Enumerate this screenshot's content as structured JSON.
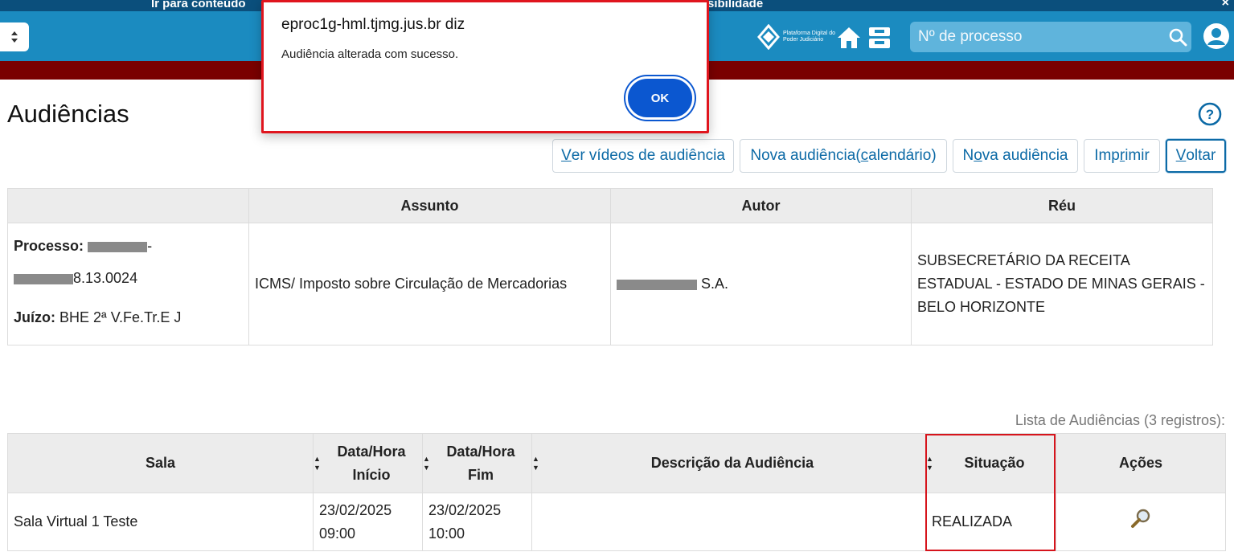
{
  "topbar": {
    "skip_content": "Ir para conteúdo",
    "accessibility": "sibilidade",
    "close": "×"
  },
  "header": {
    "logo_text": "Plataforma Digital do Poder Judiciário",
    "search_placeholder": "Nº de processo",
    "icons": [
      "select-arrows-icon",
      "pdpj-logo",
      "home-icon",
      "inbox-icon",
      "search-icon",
      "user-icon"
    ],
    "colors": {
      "header_bg": "#1b8bc0",
      "band": "#7a0000",
      "link": "#0c6aa6"
    }
  },
  "page": {
    "title": "Audiências",
    "help": "?"
  },
  "toolbar": {
    "videos": [
      "V",
      "er vídeos de audiência"
    ],
    "nova_calendario": [
      "Nova audiência(",
      "c",
      "alendário)"
    ],
    "nova": [
      "N",
      "o",
      "va audiência"
    ],
    "imprimir": [
      "Imp",
      "r",
      "imir"
    ],
    "voltar": [
      "V",
      "oltar"
    ]
  },
  "info_table": {
    "headers": [
      "",
      "Assunto",
      "Autor",
      "Réu"
    ],
    "processo_label": "Processo:",
    "processo_part1": "-",
    "processo_part2": "8.13.0024",
    "juizo_label": "Juízo:",
    "juizo_value": "BHE 2ª V.Fe.Tr.E J",
    "assunto": "ICMS/ Imposto sobre Circulação de Mercadorias",
    "autor_suffix": "S.A.",
    "reu": "SUBSECRETÁRIO DA RECEITA ESTADUAL - ESTADO DE MINAS GERAIS - BELO HORIZONTE"
  },
  "list": {
    "caption": "Lista de Audiências (3 registros):",
    "headers": {
      "sala": "Sala",
      "inicio_1": "Data/Hora",
      "inicio_2": "Início",
      "fim_1": "Data/Hora",
      "fim_2": "Fim",
      "descricao": "Descrição da Audiência",
      "situacao": "Situação",
      "acoes": "Ações"
    },
    "rows": [
      {
        "sala": "Sala Virtual 1 Teste",
        "inicio_data": "23/02/2025",
        "inicio_hora": "09:00",
        "fim_data": "23/02/2025",
        "fim_hora": "10:00",
        "descricao": "",
        "situacao": "REALIZADA",
        "acao_icon": "magnifier-icon"
      }
    ]
  },
  "dialog": {
    "title": "eproc1g-hml.tjmg.jus.br diz",
    "message": "Audiência alterada com sucesso.",
    "ok": "OK"
  }
}
